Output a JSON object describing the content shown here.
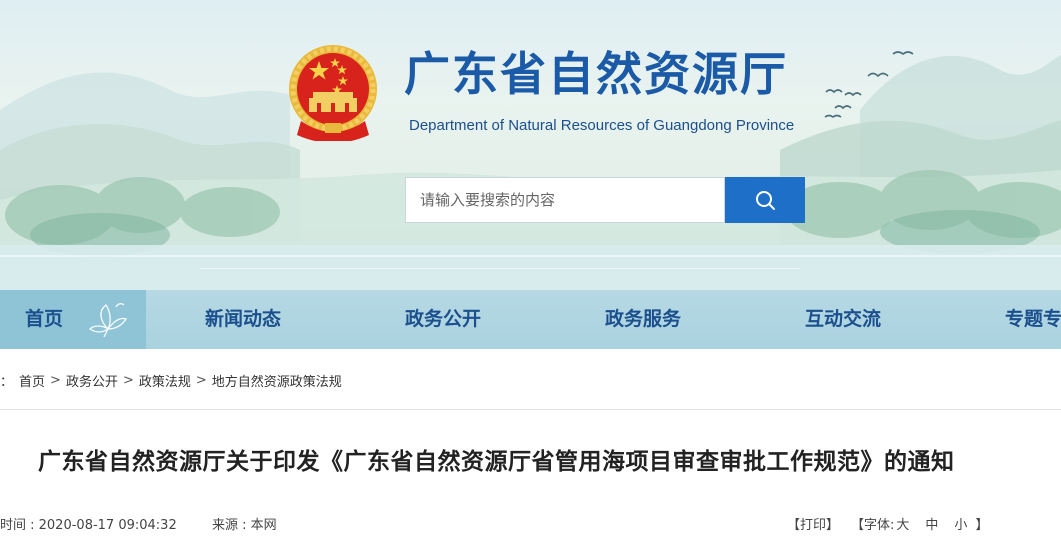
{
  "header": {
    "title": "广东省自然资源厅",
    "subtitle": "Department of Natural Resources of Guangdong Province"
  },
  "search": {
    "placeholder": "请输入要搜索的内容",
    "icon": "search-icon"
  },
  "nav": {
    "items": [
      {
        "label": "首页"
      },
      {
        "label": "新闻动态"
      },
      {
        "label": "政务公开"
      },
      {
        "label": "政务服务"
      },
      {
        "label": "互动交流"
      },
      {
        "label": "专题专"
      }
    ]
  },
  "breadcrumb": {
    "prefix": "：",
    "items": [
      {
        "label": "首页"
      },
      {
        "label": "政务公开"
      },
      {
        "label": "政策法规"
      },
      {
        "label": "地方自然资源政策法规"
      }
    ],
    "separator": ">"
  },
  "article": {
    "title": "广东省自然资源厅关于印发《广东省自然资源厅省管用海项目审查审批工作规范》的通知",
    "time": "时间 : 2020-08-17 09:04:32",
    "source": "来源 : 本网",
    "print": "【打印】",
    "font_prefix": "【字体:",
    "font_large": "大",
    "font_medium": "中",
    "font_small": "小",
    "font_suffix": "】"
  },
  "colors": {
    "brand_blue": "#1b5aa6",
    "search_button": "#1e6fc7",
    "nav_bg": "#b6d9e4",
    "nav_active_bg": "#8fc3d6"
  }
}
